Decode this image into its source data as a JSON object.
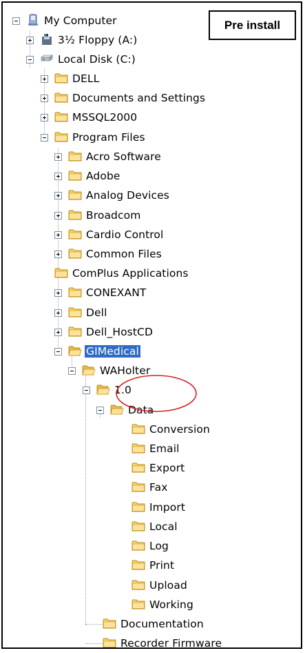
{
  "annotation": {
    "label": "Pre install",
    "highlight_color": "#d42020"
  },
  "selection": {
    "color": "#316ac5"
  },
  "tree": [
    {
      "label": "My Computer",
      "icon": "computer-icon",
      "expander": "minus"
    },
    {
      "label": "3½ Floppy (A:)",
      "icon": "floppy-icon",
      "expander": "plus"
    },
    {
      "label": "Local Disk (C:)",
      "icon": "drive-icon",
      "expander": "minus"
    },
    {
      "label": "DELL",
      "icon": "folder-icon",
      "expander": "plus"
    },
    {
      "label": "Documents and Settings",
      "icon": "folder-icon",
      "expander": "plus"
    },
    {
      "label": "MSSQL2000",
      "icon": "folder-icon",
      "expander": "plus"
    },
    {
      "label": "Program Files",
      "icon": "folder-icon",
      "expander": "minus"
    },
    {
      "label": "Acro Software",
      "icon": "folder-icon",
      "expander": "plus"
    },
    {
      "label": "Adobe",
      "icon": "folder-icon",
      "expander": "plus"
    },
    {
      "label": "Analog Devices",
      "icon": "folder-icon",
      "expander": "plus"
    },
    {
      "label": "Broadcom",
      "icon": "folder-icon",
      "expander": "plus"
    },
    {
      "label": "Cardio Control",
      "icon": "folder-icon",
      "expander": "plus"
    },
    {
      "label": "Common Files",
      "icon": "folder-icon",
      "expander": "plus"
    },
    {
      "label": "ComPlus Applications",
      "icon": "folder-icon",
      "expander": "none"
    },
    {
      "label": "CONEXANT",
      "icon": "folder-icon",
      "expander": "plus"
    },
    {
      "label": "Dell",
      "icon": "folder-icon",
      "expander": "plus"
    },
    {
      "label": "Dell_HostCD",
      "icon": "folder-icon",
      "expander": "plus"
    },
    {
      "label": "GIMedical",
      "icon": "folder-open-icon",
      "expander": "minus",
      "selected": true
    },
    {
      "label": "WAHolter",
      "icon": "folder-open-icon",
      "expander": "minus"
    },
    {
      "label": "1.0",
      "icon": "folder-open-icon",
      "expander": "minus",
      "highlighted": true
    },
    {
      "label": "Data",
      "icon": "folder-open-icon",
      "expander": "minus"
    },
    {
      "label": "Conversion",
      "icon": "folder-icon",
      "expander": "none"
    },
    {
      "label": "Email",
      "icon": "folder-icon",
      "expander": "none"
    },
    {
      "label": "Export",
      "icon": "folder-icon",
      "expander": "none"
    },
    {
      "label": "Fax",
      "icon": "folder-icon",
      "expander": "none"
    },
    {
      "label": "Import",
      "icon": "folder-icon",
      "expander": "none"
    },
    {
      "label": "Local",
      "icon": "folder-icon",
      "expander": "none"
    },
    {
      "label": "Log",
      "icon": "folder-icon",
      "expander": "none"
    },
    {
      "label": "Print",
      "icon": "folder-icon",
      "expander": "none"
    },
    {
      "label": "Upload",
      "icon": "folder-icon",
      "expander": "none"
    },
    {
      "label": "Working",
      "icon": "folder-icon",
      "expander": "none"
    },
    {
      "label": "Documentation",
      "icon": "folder-icon",
      "expander": "none"
    },
    {
      "label": "Recorder Firmware",
      "icon": "folder-icon",
      "expander": "none"
    }
  ]
}
